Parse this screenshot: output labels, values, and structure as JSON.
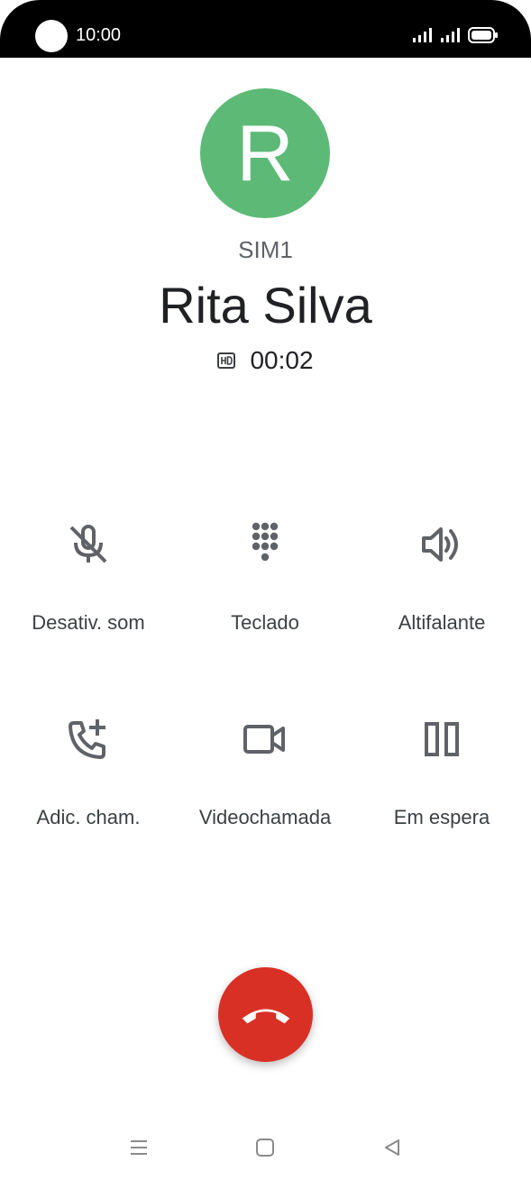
{
  "status_bar": {
    "time": "10:00"
  },
  "caller": {
    "avatar_letter": "R",
    "avatar_color": "#5dba76",
    "sim": "SIM1",
    "name": "Rita Silva",
    "duration": "00:02",
    "hd_icon": "hd-icon"
  },
  "controls": [
    {
      "label": "Desativ. som",
      "icon": "mic-off-icon"
    },
    {
      "label": "Teclado",
      "icon": "dialpad-icon"
    },
    {
      "label": "Altifalante",
      "icon": "speaker-icon"
    },
    {
      "label": "Adic. cham.",
      "icon": "add-call-icon"
    },
    {
      "label": "Videochamada",
      "icon": "videocam-icon"
    },
    {
      "label": "Em espera",
      "icon": "pause-icon"
    }
  ],
  "end_call": {
    "icon": "call-end-icon",
    "color": "#d93025"
  },
  "nav_bar": {
    "items": [
      "menu-icon",
      "home-icon",
      "back-icon"
    ]
  }
}
